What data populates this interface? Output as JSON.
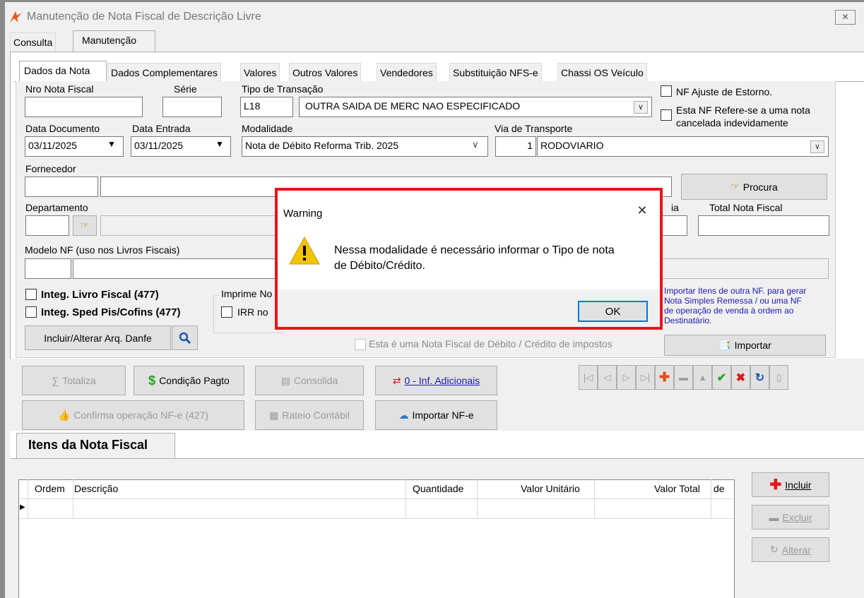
{
  "window": {
    "title": "Manutenção de Nota Fiscal de Descrição Livre",
    "close_glyph": "✕"
  },
  "outer_tabs": [
    "Consulta",
    "Manutenção"
  ],
  "inner_tabs": [
    "Dados da Nota",
    "Dados Complementares",
    "Valores",
    "Outros Valores",
    "Vendedores",
    "Substituição NFS-e",
    "Chassi OS Veículo"
  ],
  "labels": {
    "nro_nota": "Nro Nota Fiscal",
    "serie": "Série",
    "tipo_transacao": "Tipo de Transação",
    "data_documento": "Data Documento",
    "data_entrada": "Data Entrada",
    "modalidade": "Modalidade",
    "via_transporte": "Via de Transporte",
    "fornecedor": "Fornecedor",
    "departamento": "Departamento",
    "total_nota": "Total Nota Fiscal",
    "modelo_nf": "Modelo NF (uso nos Livros Fiscais)",
    "imprime": "Imprime No",
    "partial_ia": "ia"
  },
  "fields": {
    "tipo_code": "L18",
    "tipo_desc": "OUTRA SAIDA DE MERC NAO ESPECIFICADO",
    "data_documento": "03/11/2025",
    "data_entrada": "03/11/2025",
    "modalidade": "Nota de Débito Reforma Trib. 2025",
    "via_code": "1",
    "via_desc": "RODOVIARIO"
  },
  "checkboxes": {
    "nf_ajuste": "NF Ajuste de Estorno.",
    "nf_refere_1": "Esta NF Refere-se a uma nota",
    "nf_refere_2": "cancelada indevidamente",
    "integ_livro": "Integ. Livro Fiscal (477)",
    "integ_sped": "Integ. Sped Pis/Cofins (477)",
    "irr": "IRR no",
    "nf_debito": "Esta é uma Nota Fiscal de Débito / Crédito de impostos"
  },
  "buttons": {
    "procura": "Procura",
    "incluir_danfe": "Incluir/Alterar Arq. Danfe",
    "totaliza": "Totaliza",
    "condicao_pagto": "Condição Pagto",
    "consolida": "Consolida",
    "inf_adicionais": "0 - Inf. Adicionais",
    "confirma_nfe": "Confirma operação NF-e (427)",
    "rateio": "Rateio Contábil",
    "importar_nfe": "Importar NF-e",
    "importar": "Importar",
    "incluir": "Incluir",
    "excluir": "Excluir",
    "alterar": "Alterar"
  },
  "importar_note": [
    "Importar Itens de outra NF. para gerar",
    "Nota Simples Remessa / ou uma NF",
    "de operação de venda à ordem ao",
    "Destinatário."
  ],
  "items_tab": "Itens da Nota Fiscal",
  "grid_columns": [
    "Ordem",
    "Descrição",
    "Quantidade",
    "Valor Unitário",
    "Valor Total",
    "de"
  ],
  "dialog": {
    "title": "Warning",
    "message_line1": "Nessa modalidade é necessário informar o Tipo de nota",
    "message_line2": "de Débito/Crédito.",
    "ok": "OK",
    "close_glyph": "✕",
    "icon": "warning-icon"
  },
  "colors": {
    "highlight_border": "#e8141c",
    "link_blue": "#1a1ab0",
    "condicao_green": "#1ea51e"
  }
}
